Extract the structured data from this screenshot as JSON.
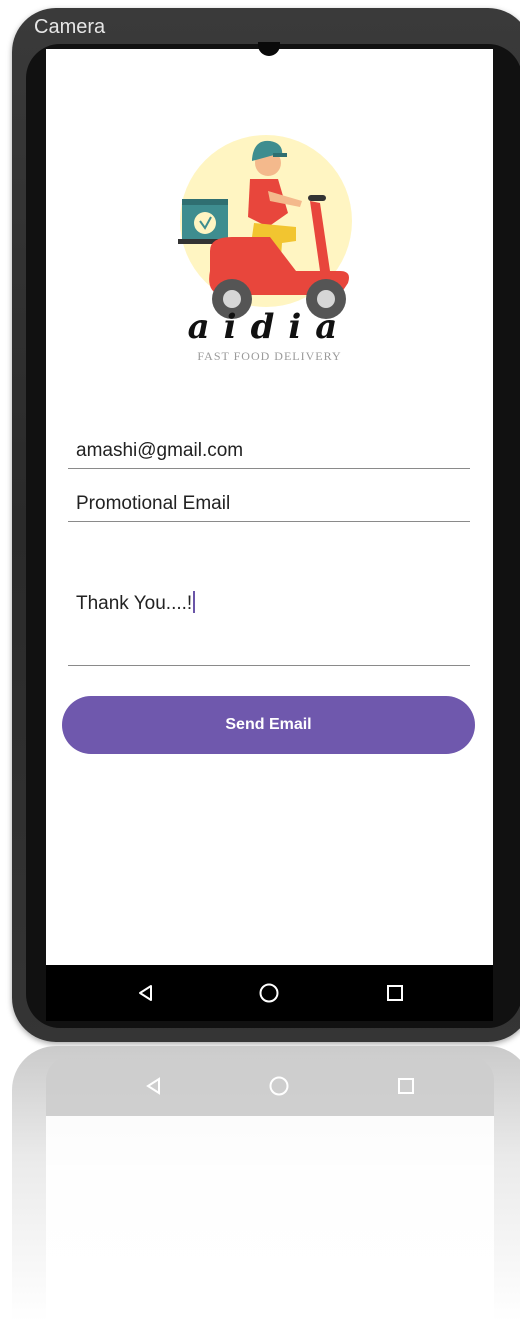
{
  "status_bar": {
    "camera_label": "Camera"
  },
  "brand": {
    "name": "aidia",
    "tagline": "FAST FOOD DELIVERY"
  },
  "form": {
    "email_value": "amashi@gmail.com",
    "subject_value": "Promotional Email",
    "message_value": "Thank You....!"
  },
  "actions": {
    "send_label": "Send Email"
  },
  "colors": {
    "accent": "#6f58ad",
    "logo_circle": "#fff5c2",
    "scooter": "#e8463c"
  },
  "nav": {
    "back_icon": "back-triangle-icon",
    "home_icon": "home-circle-icon",
    "recents_icon": "recents-square-icon"
  }
}
